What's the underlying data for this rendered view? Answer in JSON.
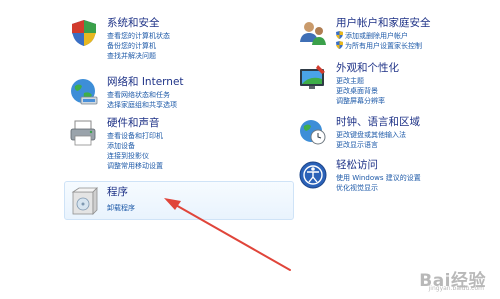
{
  "categories": {
    "system": {
      "title": "系统和安全",
      "links": [
        "查看您的计算机状态",
        "备份您的计算机",
        "查找并解决问题"
      ]
    },
    "network": {
      "title": "网络和 Internet",
      "links": [
        "查看网络状态和任务",
        "选择家庭组和共享选项"
      ]
    },
    "hardware": {
      "title": "硬件和声音",
      "links": [
        "查看设备和打印机",
        "添加设备",
        "连接到投影仪",
        "调整常用移动设置"
      ]
    },
    "programs": {
      "title": "程序",
      "links": [
        "卸载程序"
      ]
    },
    "users": {
      "title": "用户帐户和家庭安全",
      "links": [
        "添加或删除用户帐户",
        "为所有用户设置家长控制"
      ]
    },
    "appearance": {
      "title": "外观和个性化",
      "links": [
        "更改主题",
        "更改桌面背景",
        "调整屏幕分辨率"
      ]
    },
    "clock": {
      "title": "时钟、语言和区域",
      "links": [
        "更改键盘或其他输入法",
        "更改显示语言"
      ]
    },
    "ease": {
      "title": "轻松访问",
      "links": [
        "使用 Windows 建议的设置",
        "优化视觉显示"
      ]
    }
  },
  "watermark": {
    "main": "Bai经验",
    "sub": "jingyan.baidu.com"
  },
  "colors": {
    "title": "#1e3287",
    "link": "#1e5aa8",
    "arrow": "#e0453a",
    "highlight_border": "#cfe3f7"
  }
}
